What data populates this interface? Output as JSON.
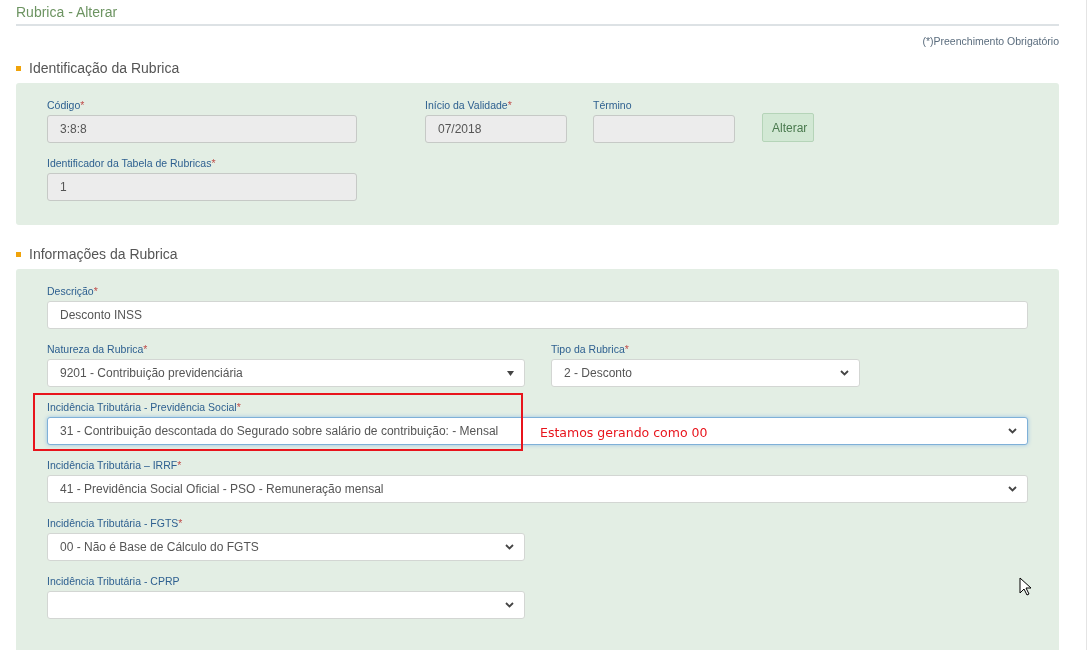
{
  "page_title": "Rubrica - Alterar",
  "required_note": "(*)Preenchimento Obrigatório",
  "sections": [
    {
      "title": "Identificação da Rubrica",
      "rows": [
        {
          "items": [
            {
              "kind": "input",
              "label": "Código",
              "required_mark": "*",
              "value": "3:8:8",
              "disabled": true,
              "focused": false
            },
            {
              "kind": "input",
              "label": "Início da Validade",
              "required_mark": "*",
              "value": "07/2018",
              "disabled": true,
              "focused": false
            },
            {
              "kind": "input",
              "label": "Término",
              "disabled": true,
              "focused": false
            },
            {
              "kind": "button",
              "label": "Alterar"
            }
          ]
        },
        {
          "items": [
            {
              "kind": "input",
              "label": "Identificador da Tabela de Rubricas ",
              "required_mark": "*",
              "value": "1",
              "disabled": true,
              "focused": false
            }
          ]
        }
      ]
    },
    {
      "title": "Informações da Rubrica",
      "rows": [
        {
          "items": [
            {
              "kind": "input",
              "label": "Descrição",
              "required_mark": "*",
              "value": "Desconto INSS",
              "disabled": false,
              "focused": false
            }
          ]
        },
        {
          "items": [
            {
              "kind": "combo",
              "label": "Natureza da Rubrica",
              "required_mark": "*",
              "value": "9201 - Contribuição previdenciária",
              "disabled": false,
              "focused": false
            },
            {
              "kind": "select",
              "label": "Tipo da Rubrica",
              "required_mark": "*",
              "value": "2 - Desconto",
              "disabled": false,
              "focused": false
            }
          ]
        },
        {
          "items": [
            {
              "kind": "select",
              "label": "Incidência Tributária - Previdência Social",
              "required_mark": "*",
              "value": "31 - Contribuição descontada do Segurado sobre salário de contribuição: - Mensal",
              "disabled": false,
              "focused": true,
              "annotation": "Estamos gerando como 00"
            }
          ]
        },
        {
          "items": [
            {
              "kind": "select",
              "label": "Incidência Tributária – IRRF",
              "required_mark": "*",
              "value": "41 - Previdência Social Oficial - PSO - Remuneração mensal",
              "disabled": false,
              "focused": false
            }
          ]
        },
        {
          "items": [
            {
              "kind": "select",
              "label": "Incidência Tributária - FGTS",
              "required_mark": "*",
              "value": "00 - Não é Base de Cálculo do FGTS",
              "disabled": false,
              "focused": false
            }
          ]
        },
        {
          "items": [
            {
              "kind": "select",
              "label": "Incidência Tributária - CPRP",
              "disabled": false,
              "focused": false
            }
          ]
        }
      ]
    }
  ]
}
